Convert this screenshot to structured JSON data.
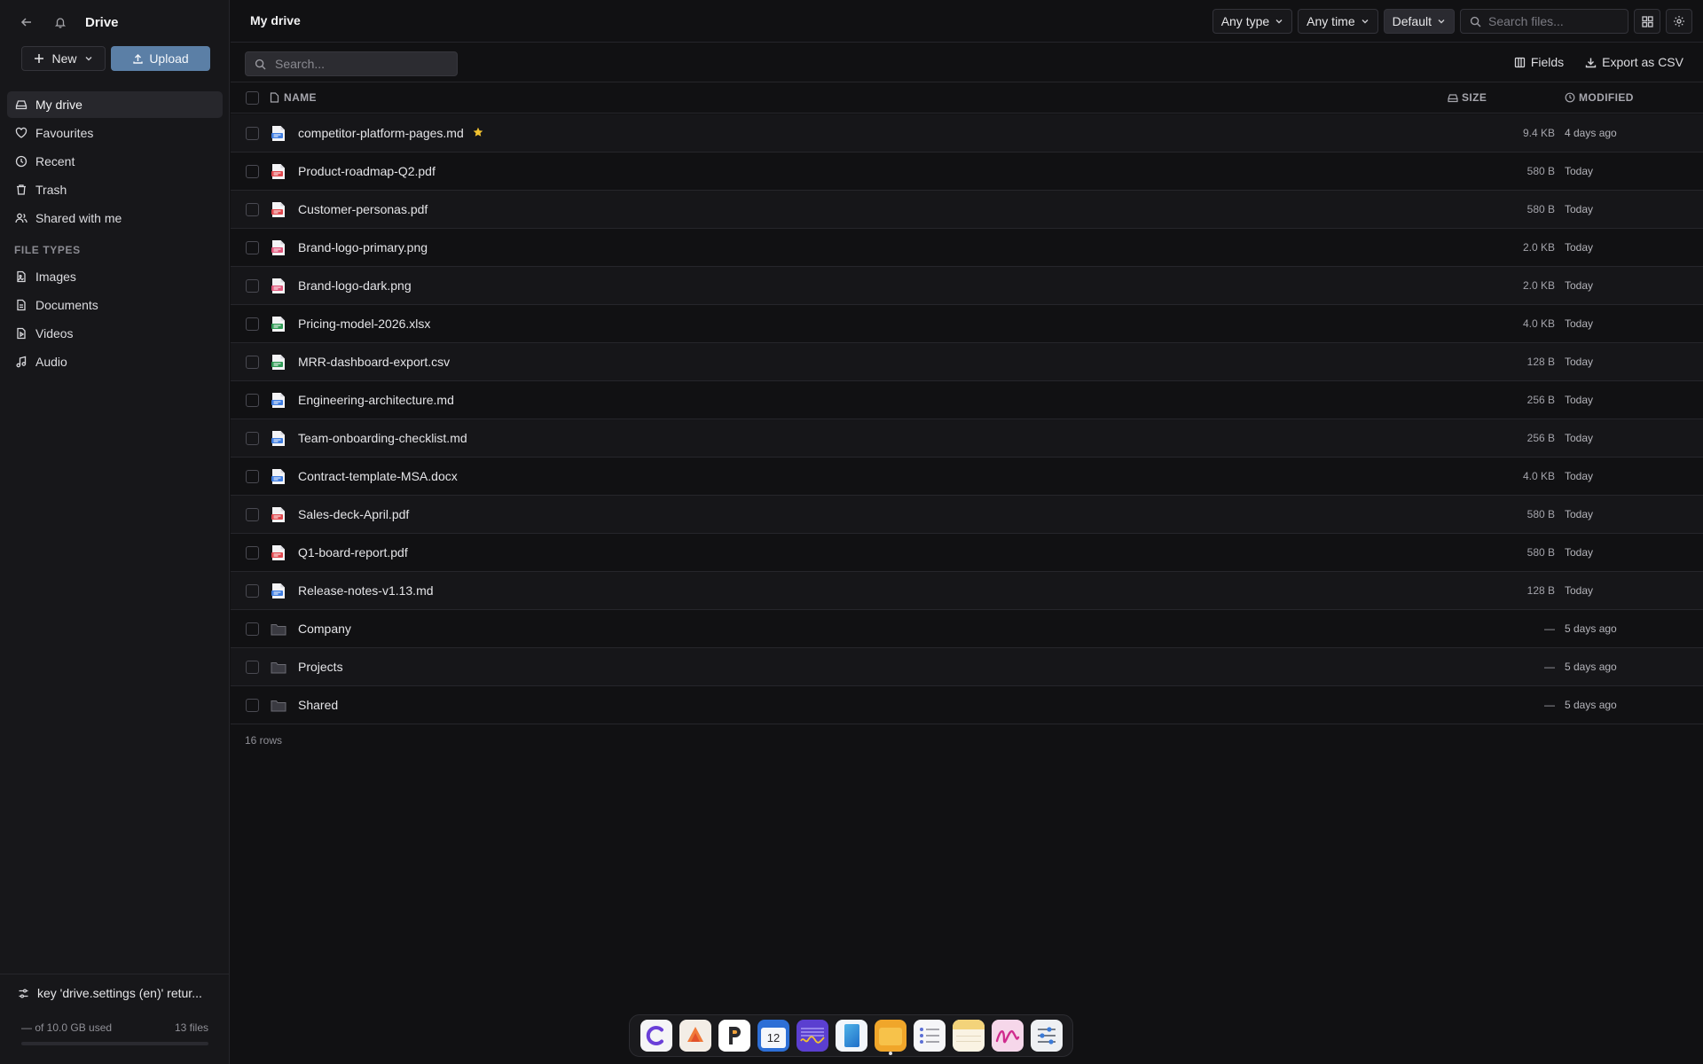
{
  "sidebar": {
    "title": "Drive",
    "new_label": "New",
    "upload_label": "Upload",
    "nav": [
      {
        "label": "My drive",
        "icon": "drive-icon",
        "active": true
      },
      {
        "label": "Favourites",
        "icon": "heart-icon"
      },
      {
        "label": "Recent",
        "icon": "clock-icon"
      },
      {
        "label": "Trash",
        "icon": "trash-icon"
      },
      {
        "label": "Shared with me",
        "icon": "users-icon"
      }
    ],
    "file_types_label": "FILE TYPES",
    "file_types": [
      {
        "label": "Images",
        "icon": "image-icon"
      },
      {
        "label": "Documents",
        "icon": "document-icon"
      },
      {
        "label": "Videos",
        "icon": "video-icon"
      },
      {
        "label": "Audio",
        "icon": "music-icon"
      }
    ],
    "alert_text": "key 'drive.settings (en)' retur...",
    "storage_used": "— of 10.0 GB used",
    "file_count": "13 files"
  },
  "header": {
    "title": "My drive",
    "type_filter": "Any type",
    "time_filter": "Any time",
    "sort": "Default",
    "search_placeholder": "Search files..."
  },
  "toolbar": {
    "search_placeholder": "Search...",
    "fields_label": "Fields",
    "export_label": "Export as CSV"
  },
  "table": {
    "columns": {
      "name": "NAME",
      "size": "SIZE",
      "modified": "MODIFIED"
    },
    "rows": [
      {
        "name": "competitor-platform-pages.md",
        "kind": "doc",
        "size": "9.4 KB",
        "modified": "4 days ago",
        "starred": true
      },
      {
        "name": "Product-roadmap-Q2.pdf",
        "kind": "pdf",
        "size": "580 B",
        "modified": "Today"
      },
      {
        "name": "Customer-personas.pdf",
        "kind": "pdf",
        "size": "580 B",
        "modified": "Today"
      },
      {
        "name": "Brand-logo-primary.png",
        "kind": "img",
        "size": "2.0 KB",
        "modified": "Today"
      },
      {
        "name": "Brand-logo-dark.png",
        "kind": "img",
        "size": "2.0 KB",
        "modified": "Today"
      },
      {
        "name": "Pricing-model-2026.xlsx",
        "kind": "sheet",
        "size": "4.0 KB",
        "modified": "Today"
      },
      {
        "name": "MRR-dashboard-export.csv",
        "kind": "sheet",
        "size": "128 B",
        "modified": "Today"
      },
      {
        "name": "Engineering-architecture.md",
        "kind": "doc",
        "size": "256 B",
        "modified": "Today"
      },
      {
        "name": "Team-onboarding-checklist.md",
        "kind": "doc",
        "size": "256 B",
        "modified": "Today"
      },
      {
        "name": "Contract-template-MSA.docx",
        "kind": "doc",
        "size": "4.0 KB",
        "modified": "Today"
      },
      {
        "name": "Sales-deck-April.pdf",
        "kind": "pdf",
        "size": "580 B",
        "modified": "Today"
      },
      {
        "name": "Q1-board-report.pdf",
        "kind": "pdf",
        "size": "580 B",
        "modified": "Today"
      },
      {
        "name": "Release-notes-v1.13.md",
        "kind": "doc",
        "size": "128 B",
        "modified": "Today"
      },
      {
        "name": "Company",
        "kind": "folder",
        "size": "—",
        "modified": "5 days ago"
      },
      {
        "name": "Projects",
        "kind": "folder",
        "size": "—",
        "modified": "5 days ago"
      },
      {
        "name": "Shared",
        "kind": "folder",
        "size": "—",
        "modified": "5 days ago"
      }
    ],
    "row_count": "16 rows"
  },
  "colors": {
    "accent": "#5b7fa6",
    "pdf": "#e0484e",
    "doc": "#3f7de0",
    "sheet": "#2f9a55",
    "img": "#e0587c",
    "star": "#f2c230"
  },
  "dock": {
    "apps": [
      "c-app-icon",
      "shapes-app-icon",
      "p-app-icon",
      "calendar-app-icon",
      "waveform-app-icon",
      "book-app-icon",
      "folder-app-icon",
      "list-app-icon",
      "notes-app-icon",
      "scribble-app-icon",
      "settings-app-icon"
    ],
    "calendar_day": "12"
  }
}
